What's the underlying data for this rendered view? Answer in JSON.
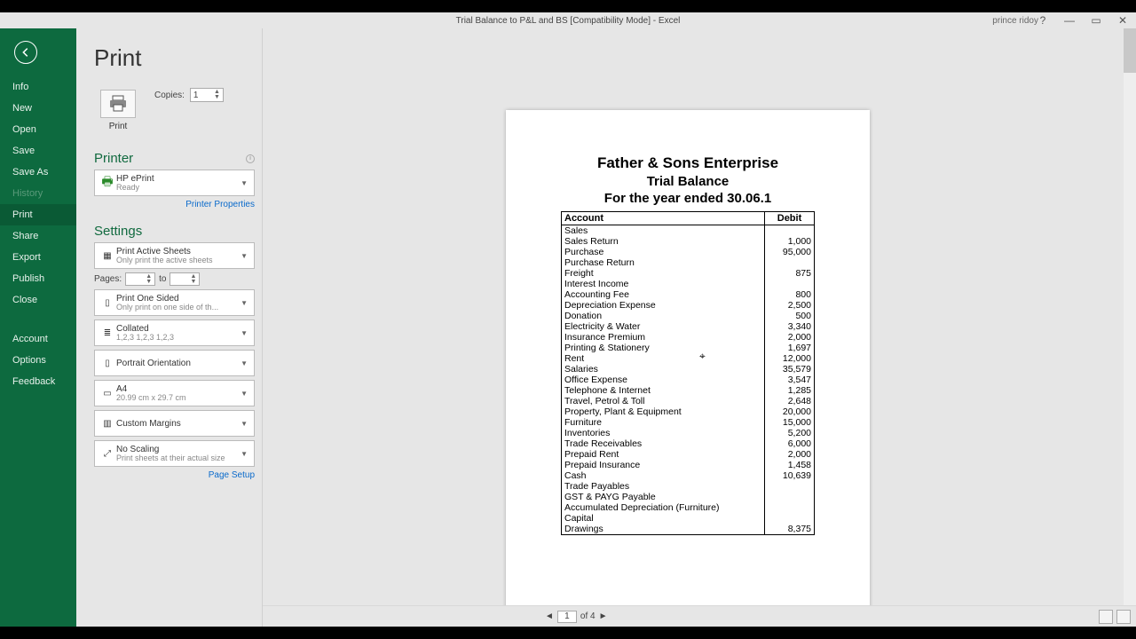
{
  "titlebar": {
    "title": "Trial Balance to P&L and BS  [Compatibility Mode] - Excel",
    "user": "prince ridoy"
  },
  "greenmenu": {
    "items": [
      "Info",
      "New",
      "Open",
      "Save",
      "Save As",
      "History",
      "Print",
      "Share",
      "Export",
      "Publish",
      "Close"
    ],
    "active": "Print",
    "disabled": "History",
    "bottom": [
      "Account",
      "Options",
      "Feedback"
    ]
  },
  "print": {
    "title": "Print",
    "button_label": "Print",
    "copies_label": "Copies:",
    "copies_value": "1"
  },
  "printer": {
    "section": "Printer",
    "name": "HP ePrint",
    "status": "Ready",
    "properties": "Printer Properties"
  },
  "settings": {
    "section": "Settings",
    "active_sheets": {
      "t1": "Print Active Sheets",
      "t2": "Only print the active sheets"
    },
    "pages_label": "Pages:",
    "to_label": "to",
    "one_sided": {
      "t1": "Print One Sided",
      "t2": "Only print on one side of th..."
    },
    "collated": {
      "t1": "Collated",
      "t2": "1,2,3   1,2,3   1,2,3"
    },
    "orientation": {
      "t1": "Portrait Orientation",
      "t2": ""
    },
    "paper": {
      "t1": "A4",
      "t2": "20.99 cm x 29.7 cm"
    },
    "margins": {
      "t1": "Custom Margins",
      "t2": ""
    },
    "scaling": {
      "t1": "No Scaling",
      "t2": "Print sheets at their actual size"
    },
    "page_setup": "Page Setup"
  },
  "nav": {
    "page": "1",
    "of": "of 4"
  },
  "preview": {
    "h1": "Father & Sons Enterprise",
    "h2": "Trial Balance",
    "h3": "For the year ended 30.06.1",
    "col_account": "Account",
    "col_debit": "Debit",
    "rows": [
      {
        "a": "Sales",
        "d": ""
      },
      {
        "a": "Sales Return",
        "d": "1,000"
      },
      {
        "a": "Purchase",
        "d": "95,000"
      },
      {
        "a": "Purchase Return",
        "d": ""
      },
      {
        "a": "Freight",
        "d": "875"
      },
      {
        "a": "Interest Income",
        "d": ""
      },
      {
        "a": "Accounting Fee",
        "d": "800"
      },
      {
        "a": "Depreciation Expense",
        "d": "2,500"
      },
      {
        "a": "Donation",
        "d": "500"
      },
      {
        "a": "Electricity & Water",
        "d": "3,340"
      },
      {
        "a": "Insurance Premium",
        "d": "2,000"
      },
      {
        "a": "Printing & Stationery",
        "d": "1,697"
      },
      {
        "a": "Rent",
        "d": "12,000"
      },
      {
        "a": "Salaries",
        "d": "35,579"
      },
      {
        "a": "Office Expense",
        "d": "3,547"
      },
      {
        "a": "Telephone & Internet",
        "d": "1,285"
      },
      {
        "a": "Travel, Petrol & Toll",
        "d": "2,648"
      },
      {
        "a": "Property, Plant & Equipment",
        "d": "20,000"
      },
      {
        "a": "Furniture",
        "d": "15,000"
      },
      {
        "a": "Inventories",
        "d": "5,200"
      },
      {
        "a": "Trade Receivables",
        "d": "6,000"
      },
      {
        "a": "Prepaid Rent",
        "d": "2,000"
      },
      {
        "a": "Prepaid Insurance",
        "d": "1,458"
      },
      {
        "a": "Cash",
        "d": "10,639"
      },
      {
        "a": "Trade Payables",
        "d": ""
      },
      {
        "a": "GST & PAYG Payable",
        "d": ""
      },
      {
        "a": "Accumulated Depreciation (Furniture)",
        "d": ""
      },
      {
        "a": "Capital",
        "d": ""
      },
      {
        "a": "Drawings",
        "d": "8,375"
      }
    ]
  }
}
